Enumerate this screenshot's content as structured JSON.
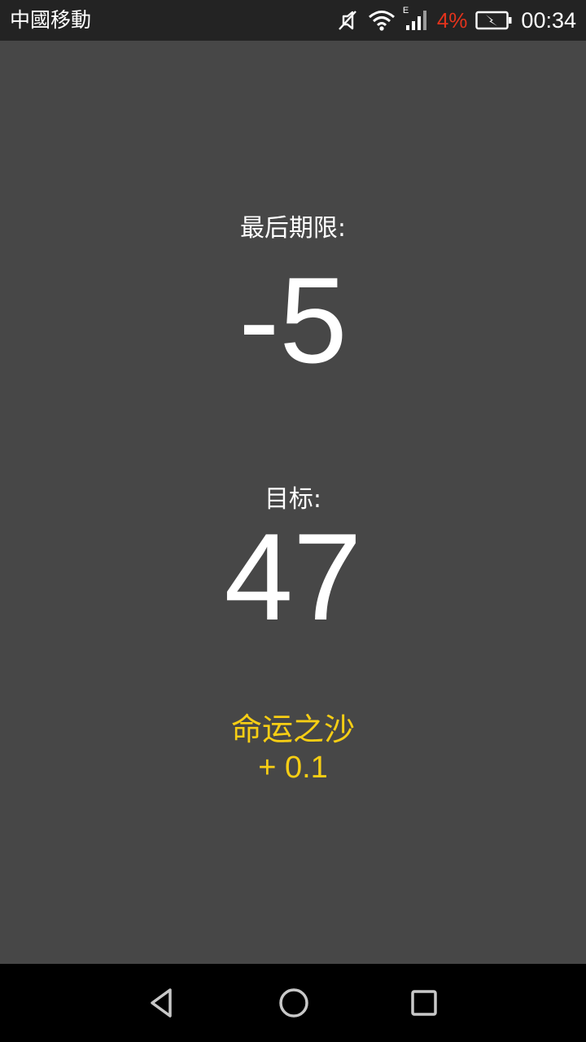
{
  "status_bar": {
    "carrier": "中國移動",
    "network_type": "E",
    "battery_percent": "4%",
    "battery_color": "#e2331c",
    "time": "00:34",
    "icons": [
      "mute-icon",
      "wifi-icon",
      "cell-signal-icon",
      "battery-charging-icon"
    ]
  },
  "main": {
    "deadline_label": "最后期限:",
    "deadline_value": "-5",
    "target_label": "目标:",
    "target_value": "47",
    "sand_name": "命运之沙",
    "sand_value": "+ 0.1",
    "accent_color": "#f7ce14",
    "background_color": "#474747"
  },
  "nav_bar": {
    "icons": [
      "back-icon",
      "home-icon",
      "recent-apps-icon"
    ]
  }
}
